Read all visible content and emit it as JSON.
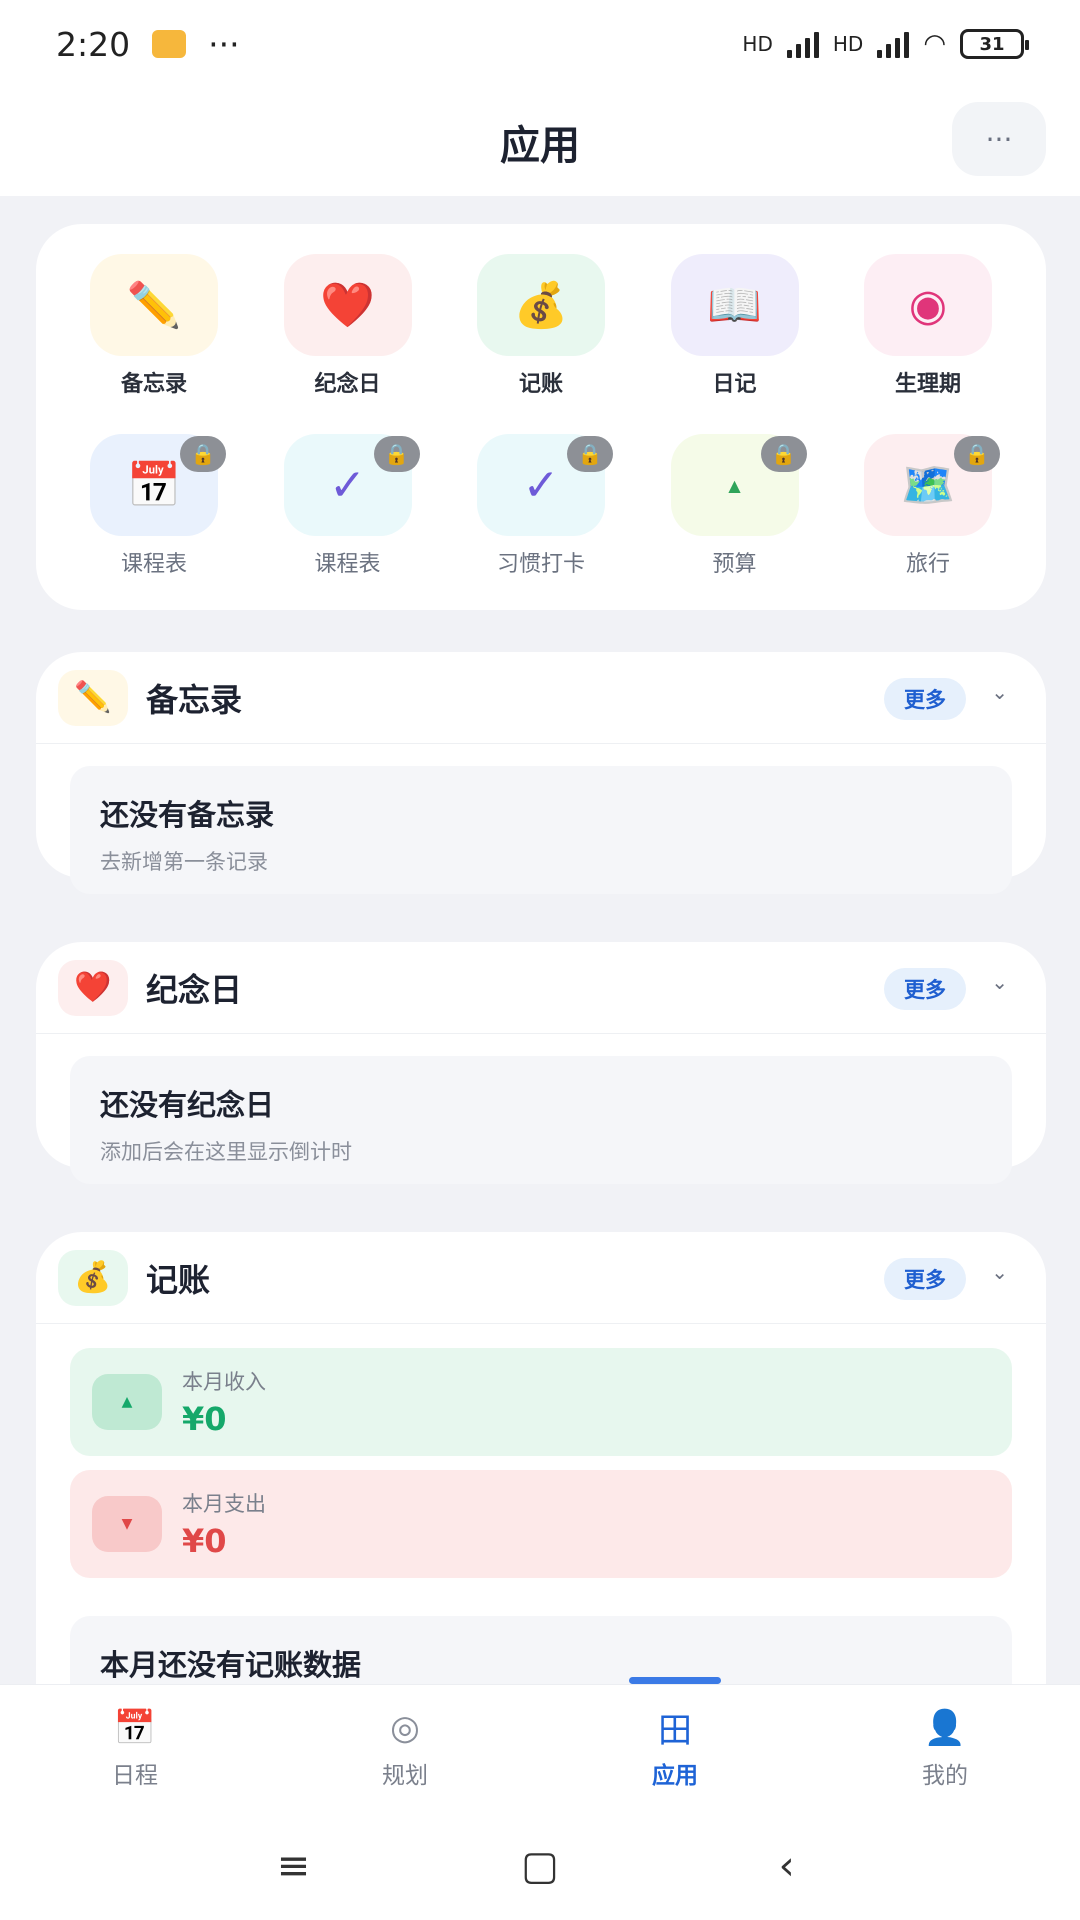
{
  "status_bar": {
    "time": "2:20",
    "dots": "···",
    "net1": "HD",
    "net2": "HD",
    "battery": "31"
  },
  "header": {
    "title": "应用",
    "more_icon": "···"
  },
  "apps": [
    {
      "label": "备忘录",
      "icon": "✏️",
      "bg": "#fff8e6",
      "locked": false
    },
    {
      "label": "纪念日",
      "icon": "❤️",
      "bg": "#fdeeee",
      "locked": false
    },
    {
      "label": "记账",
      "icon": "💰",
      "bg": "#e8f8ef",
      "locked": false
    },
    {
      "label": "日记",
      "icon": "📖",
      "bg": "#efedfc",
      "locked": false
    },
    {
      "label": "生理期",
      "icon": "◉",
      "bg": "#fdeef4",
      "locked": false
    },
    {
      "label": "课程表",
      "icon": "📅",
      "bg": "#e9f1fd",
      "locked": true
    },
    {
      "label": "课程表",
      "icon": "✓",
      "bg": "#eaf9fb",
      "locked": true
    },
    {
      "label": "习惯打卡",
      "icon": "✓",
      "bg": "#eaf9fb",
      "locked": true
    },
    {
      "label": "预算",
      "icon": "▲",
      "bg": "#f5fbe8",
      "locked": true
    },
    {
      "label": "旅行",
      "icon": "🗺️",
      "bg": "#fdeef0",
      "locked": true
    }
  ],
  "memo": {
    "title": "备忘录",
    "more": "更多",
    "empty_title": "还没有备忘录",
    "empty_sub": "去新增第一条记录"
  },
  "anniv": {
    "title": "纪念日",
    "more": "更多",
    "empty_title": "还没有纪念日",
    "empty_sub": "添加后会在这里显示倒计时"
  },
  "ledger": {
    "title": "记账",
    "more": "更多",
    "income_label": "本月收入",
    "income_value": "¥0",
    "expense_label": "本月支出",
    "expense_value": "¥0",
    "empty_title": "本月还没有记账数据"
  },
  "tabs": [
    {
      "label": "日程",
      "icon": "📅",
      "active": false
    },
    {
      "label": "规划",
      "icon": "◎",
      "active": false
    },
    {
      "label": "应用",
      "icon": "田",
      "active": true
    },
    {
      "label": "我的",
      "icon": "👤",
      "active": false
    }
  ],
  "colors": {
    "accent": "#1e63d6",
    "income": "#15a86a",
    "expense": "#e04848"
  }
}
